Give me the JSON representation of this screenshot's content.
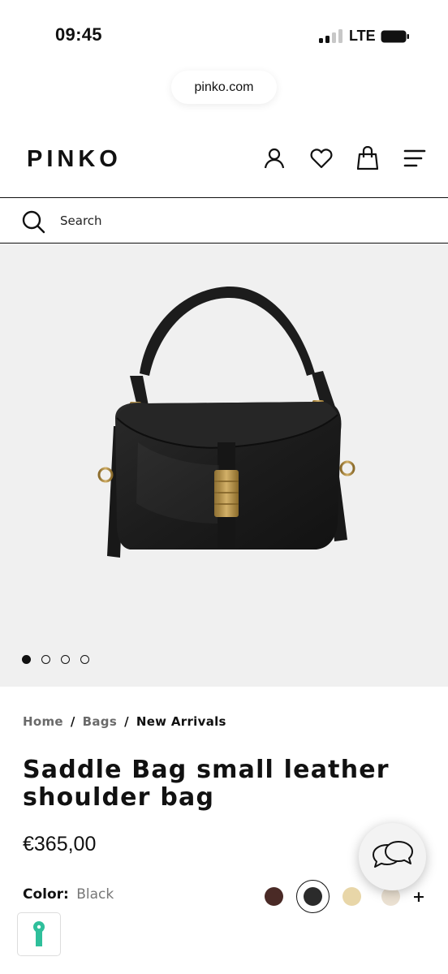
{
  "status_bar": {
    "time": "09:45",
    "network": "LTE",
    "signal_icon": "signal-icon",
    "battery_icon": "battery-icon"
  },
  "browser": {
    "url": "pinko.com"
  },
  "header": {
    "logo": "PINKO",
    "icons": [
      "user-icon",
      "heart-icon",
      "shopping-bag-icon",
      "menu-icon"
    ]
  },
  "search": {
    "placeholder": "Search",
    "icon": "search-icon"
  },
  "gallery": {
    "image_count": 4,
    "active_index": 0
  },
  "breadcrumb": {
    "items": [
      "Home",
      "Bags"
    ],
    "separator": "/",
    "current": "New Arrivals"
  },
  "product": {
    "title": "Saddle Bag small leather shoulder bag",
    "price": "€365,00",
    "color_label": "Color:",
    "color_value": "Black",
    "swatches": [
      "#4a2a26",
      "#2b2b2b",
      "#e8d6a8",
      "#ebe1d2"
    ],
    "selected_swatch": 1,
    "more_colors": "+"
  },
  "floating": {
    "chat_icon": "chat-bubbles-icon",
    "accessibility_icon": "accessibility-icon"
  }
}
